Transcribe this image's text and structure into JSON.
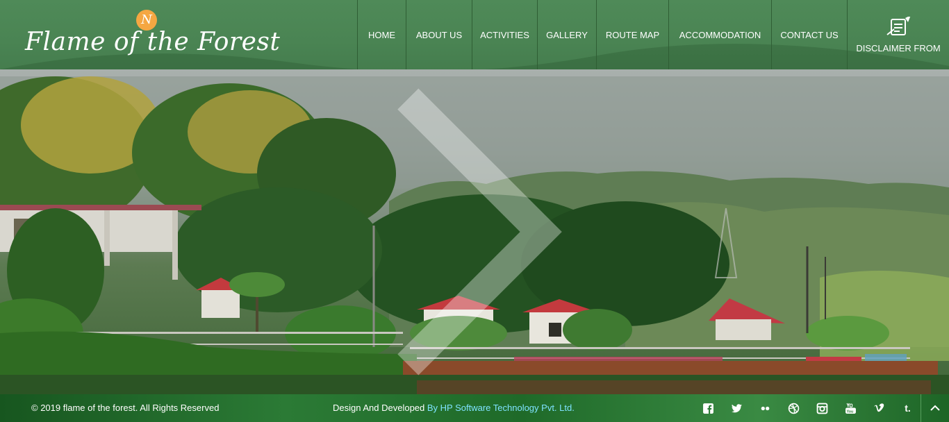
{
  "brand": {
    "badge": "N",
    "name": "Flame of the Forest"
  },
  "nav": {
    "items": [
      {
        "label": "HOME"
      },
      {
        "label": "ABOUT US"
      },
      {
        "label": "ACTIVITIES"
      },
      {
        "label": "GALLERY"
      },
      {
        "label": "ROUTE MAP"
      },
      {
        "label": "ACCOMMODATION"
      },
      {
        "label": "CONTACT US"
      }
    ],
    "disclaimer": {
      "label": "DISCLAIMER FROM",
      "icon": "document-quill-icon"
    }
  },
  "hero": {
    "next_icon": "chevron-right-icon"
  },
  "footer": {
    "copyright": "© 2019 flame of the forest. All Rights Reserved",
    "credit_prefix": "Design And Developed ",
    "credit_link": "By HP Software Technology Pvt. Ltd.",
    "social": [
      {
        "name": "facebook-icon",
        "glyph": "f"
      },
      {
        "name": "twitter-icon",
        "glyph": ""
      },
      {
        "name": "flickr-icon",
        "glyph": ""
      },
      {
        "name": "dribbble-icon",
        "glyph": ""
      },
      {
        "name": "instagram-icon",
        "glyph": ""
      },
      {
        "name": "youtube-icon",
        "glyph": ""
      },
      {
        "name": "vimeo-icon",
        "glyph": "v"
      },
      {
        "name": "tumblr-icon",
        "glyph": "t."
      }
    ],
    "to_top_icon": "chevron-up-icon"
  },
  "colors": {
    "header_green": "#4a8453",
    "footer_green": "#2b7a35",
    "badge_orange": "#f5a742",
    "link_cyan": "#7fe3ff"
  }
}
